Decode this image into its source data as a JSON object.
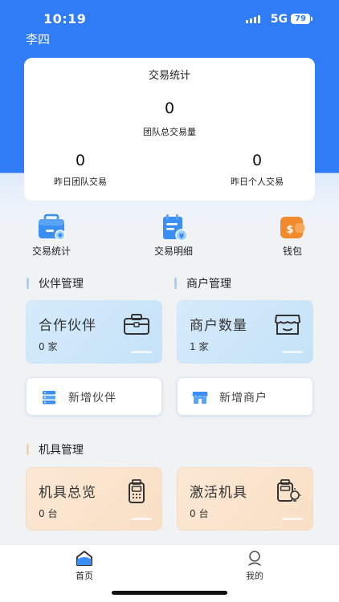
{
  "status_bar": {
    "time": "10:19",
    "network": "5G",
    "battery": "79"
  },
  "user": {
    "name": "李四"
  },
  "stats_card": {
    "title": "交易统计",
    "team_total_value": "0",
    "team_total_label": "团队总交易量",
    "yesterday_team_value": "0",
    "yesterday_team_label": "昨日团队交易",
    "yesterday_personal_value": "0",
    "yesterday_personal_label": "昨日个人交易"
  },
  "shortcuts": [
    {
      "label": "交易统计",
      "icon": "briefcase-stats-icon"
    },
    {
      "label": "交易明细",
      "icon": "calendar-yen-icon"
    },
    {
      "label": "钱包",
      "icon": "wallet-icon"
    }
  ],
  "partner_section": {
    "title": "伙伴管理",
    "tile_title": "合作伙伴",
    "tile_value": "0 家",
    "add_label": "新增伙伴"
  },
  "merchant_section": {
    "title": "商户管理",
    "tile_title": "商户数量",
    "tile_value": "1 家",
    "add_label": "新增商户"
  },
  "device_section": {
    "title": "机具管理",
    "overview_title": "机具总览",
    "overview_value": "0 台",
    "activate_title": "激活机具",
    "activate_value": "0 台"
  },
  "tabs": [
    {
      "label": "首页",
      "icon": "home-icon",
      "active": true
    },
    {
      "label": "我的",
      "icon": "profile-icon",
      "active": false
    }
  ],
  "colors": {
    "primary": "#2f7cf6",
    "accent_orange": "#f2a65a",
    "section_blue": "#8cc0f3",
    "section_orange": "#f7c9a0"
  }
}
